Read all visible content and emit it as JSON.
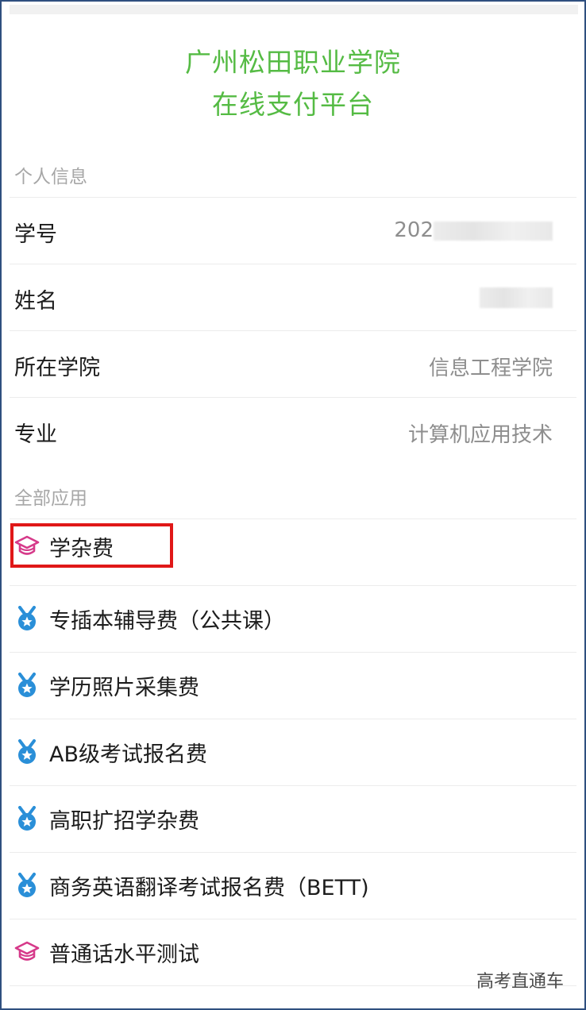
{
  "header": {
    "title_line1": "广州松田职业学院",
    "title_line2": "在线支付平台",
    "color": "#55bb44"
  },
  "personal_info": {
    "section_label": "个人信息",
    "rows": [
      {
        "label": "学号",
        "value": "202"
      },
      {
        "label": "姓名",
        "value": ""
      },
      {
        "label": "所在学院",
        "value": "信息工程学院"
      },
      {
        "label": "专业",
        "value": "计算机应用技术"
      }
    ]
  },
  "apps": {
    "section_label": "全部应用",
    "items": [
      {
        "label": "学杂费",
        "icon": "graduation-cap-icon",
        "highlighted": true
      },
      {
        "label": "专插本辅导费（公共课）",
        "icon": "medal-icon"
      },
      {
        "label": "学历照片采集费",
        "icon": "medal-icon"
      },
      {
        "label": "AB级考试报名费",
        "icon": "medal-icon"
      },
      {
        "label": "高职扩招学杂费",
        "icon": "medal-icon"
      },
      {
        "label": "商务英语翻译考试报名费（BETT)",
        "icon": "medal-icon"
      },
      {
        "label": "普通话水平测试",
        "icon": "graduation-cap-icon"
      }
    ]
  },
  "watermark": "高考直通车",
  "colors": {
    "highlight_border": "#e01818",
    "cap_icon": "#d63a8a",
    "medal_icon": "#2a8fd8"
  }
}
